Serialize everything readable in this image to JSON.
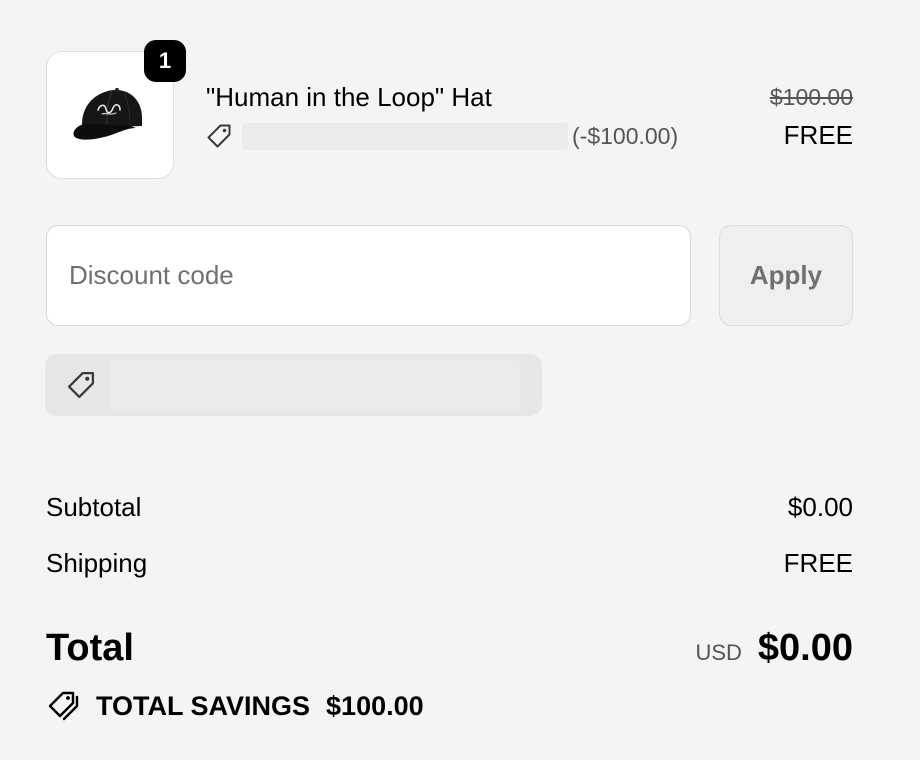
{
  "cart": {
    "item": {
      "quantity": "1",
      "name": "\"Human in the Loop\" Hat",
      "discount_amount": "(-$100.00)",
      "original_price": "$100.00",
      "final_price": "FREE",
      "image_icon": "black-baseball-cap"
    }
  },
  "discount": {
    "placeholder": "Discount code",
    "value": "",
    "apply_label": "Apply",
    "tag_icon": "price-tag-icon"
  },
  "summary": {
    "subtotal_label": "Subtotal",
    "subtotal_value": "$0.00",
    "shipping_label": "Shipping",
    "shipping_value": "FREE",
    "total_label": "Total",
    "currency": "USD",
    "total_value": "$0.00",
    "savings_label": "TOTAL SAVINGS",
    "savings_value": "$100.00",
    "savings_icon": "price-tags-icon"
  },
  "colors": {
    "background": "#f4f4f4",
    "text": "#000000",
    "muted_text": "#707070",
    "badge": "#000000",
    "redaction": "#ebebeb"
  }
}
